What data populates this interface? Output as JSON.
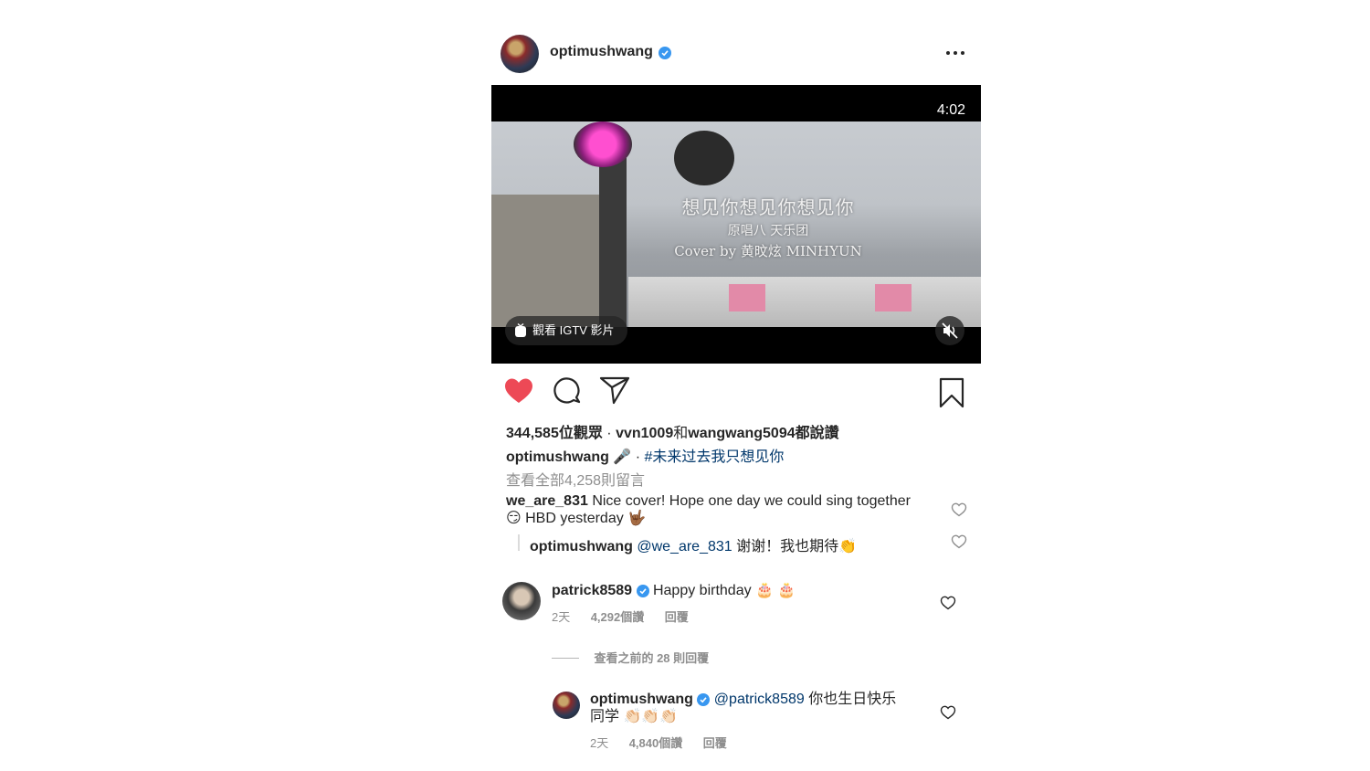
{
  "post": {
    "username": "optimushwang",
    "video": {
      "duration": "4:02",
      "caption_line1": "想见你想见你想见你",
      "caption_line2": "原唱八 天乐团",
      "caption_line3": "Cover by 黄旼炫 MINHYUN",
      "igtv_button_label": "觀看 IGTV 影片"
    },
    "views": "344,585位觀眾",
    "liked_by_sep": " · ",
    "liked_by_user1": "vvn1009",
    "liked_by_and": "和",
    "liked_by_user2": "wangwang5094",
    "liked_by_suffix": "都說讚",
    "caption_username": "optimushwang",
    "caption_mic": "🎤",
    "caption_dot": " · ",
    "caption_hashtag": "#未来过去我只想见你",
    "view_all_comments": "查看全部4,258則留言"
  },
  "preview_comments": [
    {
      "username": "we_are_831",
      "text_line1": "Nice cover! Hope one day we could sing together",
      "text_line2": "😏 HBD yesterday 🤟🏾"
    },
    {
      "username": "optimushwang",
      "mention": "@we_are_831",
      "text": "谢谢！我也期待👏"
    }
  ],
  "comments": [
    {
      "username": "patrick8589",
      "text": "Happy birthday 🎂 🎂",
      "time": "2天",
      "likes": "4,292個讚",
      "reply_label": "回覆"
    }
  ],
  "view_previous_replies": "查看之前的 28 則回覆",
  "reply": {
    "username": "optimushwang",
    "mention": "@patrick8589",
    "text_line1": "你也生日快乐",
    "text_line2": "同学 👏🏻👏🏻👏🏻",
    "time": "2天",
    "likes": "4,840個讚",
    "reply_label": "回覆"
  },
  "colors": {
    "like_red": "#ed4956",
    "link_blue": "#00376b",
    "verified_blue": "#3897f0",
    "muted_gray": "#8e8e8e"
  }
}
